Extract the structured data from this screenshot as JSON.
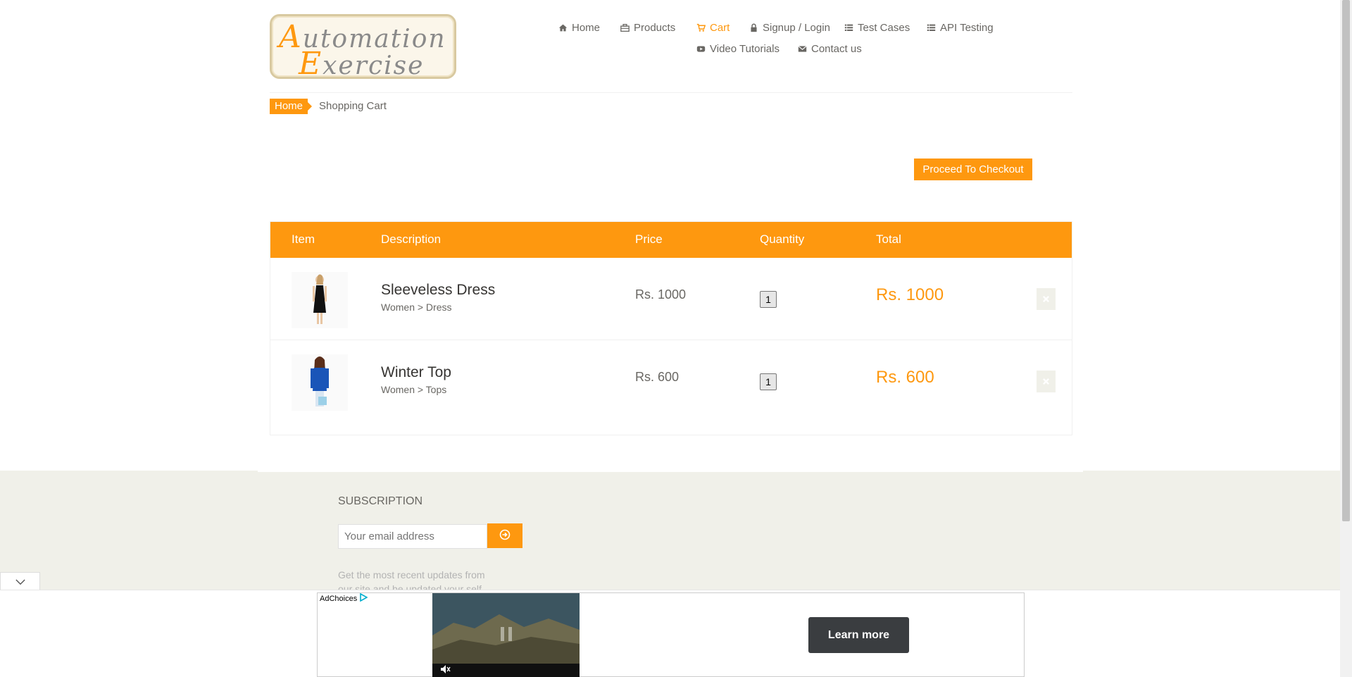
{
  "logo": {
    "line1_cap": "A",
    "line1_rest": "utomation",
    "line2_cap": "E",
    "line2_rest": "xercise"
  },
  "nav": {
    "items": [
      {
        "label": "Home",
        "icon": "home-icon"
      },
      {
        "label": "Products",
        "icon": "briefcase-icon"
      },
      {
        "label": "Cart",
        "icon": "shopping-cart-icon",
        "active": true
      },
      {
        "label": "Signup / Login",
        "icon": "lock-icon"
      },
      {
        "label": "Test Cases",
        "icon": "list-icon"
      },
      {
        "label": "API Testing",
        "icon": "list-icon"
      },
      {
        "label": "Video Tutorials",
        "icon": "youtube-play-icon"
      },
      {
        "label": "Contact us",
        "icon": "envelope-icon"
      }
    ]
  },
  "breadcrumb": {
    "home": "Home",
    "current": "Shopping Cart"
  },
  "checkout_label": "Proceed To Checkout",
  "cart": {
    "columns": [
      "Item",
      "Description",
      "Price",
      "Quantity",
      "Total"
    ],
    "rows": [
      {
        "name": "Sleeveless Dress",
        "category": "Women > Dress",
        "price": "Rs. 1000",
        "quantity": "1",
        "total": "Rs. 1000"
      },
      {
        "name": "Winter Top",
        "category": "Women > Tops",
        "price": "Rs. 600",
        "quantity": "1",
        "total": "Rs. 600"
      }
    ]
  },
  "footer": {
    "subscription_title": "SUBSCRIPTION",
    "email_placeholder": "Your email address",
    "note": "Get the most recent updates from our site and be updated your self..."
  },
  "ad": {
    "adchoices": "AdChoices",
    "cta": "Learn more"
  },
  "colors": {
    "accent": "#FE980F",
    "text": "#696763",
    "footer_bg": "#F0F0E9"
  }
}
